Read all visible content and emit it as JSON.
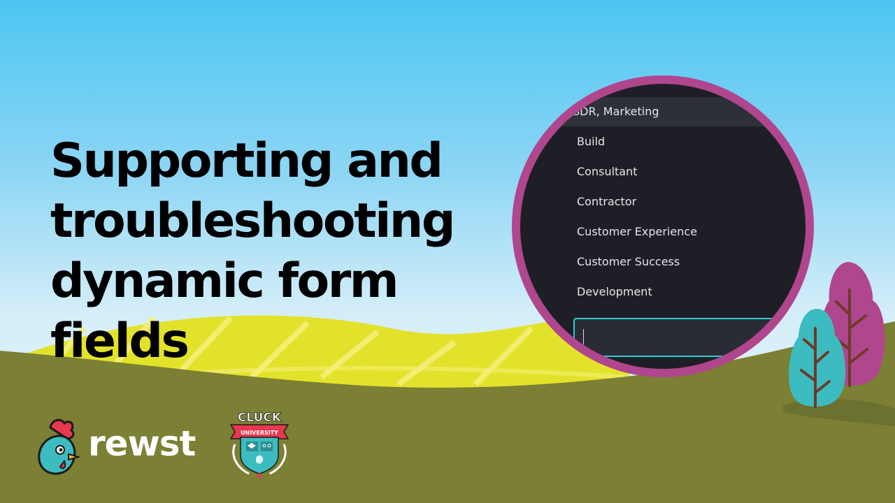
{
  "title_lines": [
    "Supporting and",
    "troubleshooting",
    "dynamic form",
    "fields"
  ],
  "dropdown": {
    "items": [
      "SDR, Marketing",
      "Build",
      "Consultant",
      "Contractor",
      "Customer Experience",
      "Customer Success",
      "Development"
    ],
    "highlighted_index": 0,
    "search_value": ""
  },
  "brand": {
    "logo_text": "rewst",
    "badge_top_text": "CLUCK",
    "badge_ribbon_text": "UNIVERSITY"
  },
  "colors": {
    "sky_top": "#4cc6f2",
    "grass": "#7b8035",
    "field_yellow": "#e3e22a",
    "lens_ring": "#b0468e",
    "menu_bg": "#1e1f26",
    "input_border": "#2ccfd2",
    "tree_teal": "#3cbcc0",
    "tree_pink": "#b0468e"
  }
}
